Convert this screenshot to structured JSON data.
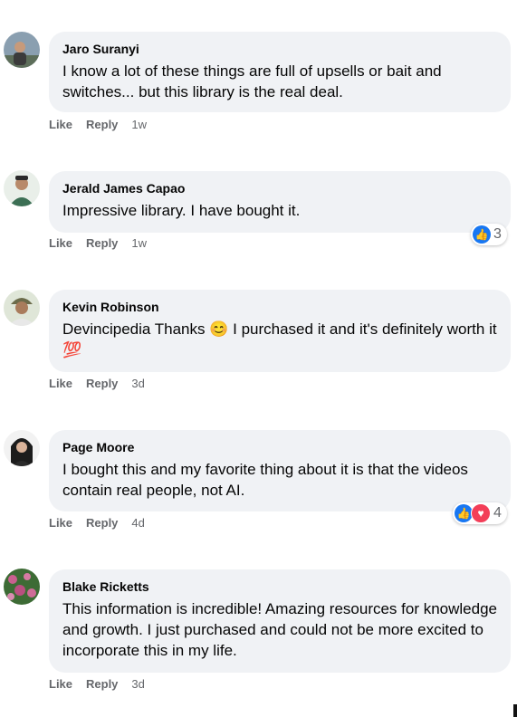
{
  "comments": [
    {
      "author": "Jaro Suranyi",
      "text": "I know a lot of these things are full of upsells or bait and switches... but this library is the real deal.",
      "like": "Like",
      "reply": "Reply",
      "time": "1w",
      "reaction_count": ""
    },
    {
      "author": "Jerald James Capao",
      "text": "Impressive library. I have bought it.",
      "like": "Like",
      "reply": "Reply",
      "time": "1w",
      "reaction_count": "3"
    },
    {
      "author": "Kevin Robinson",
      "text_before": "Devincipedia Thanks ",
      "emoji1": "😊",
      "text_mid": " I purchased it and it's definitely worth it ",
      "emoji2": "💯",
      "like": "Like",
      "reply": "Reply",
      "time": "3d"
    },
    {
      "author": "Page Moore",
      "text": "I bought this and my favorite thing about it is that the videos contain real people, not AI.",
      "like": "Like",
      "reply": "Reply",
      "time": "4d",
      "reaction_count": "4"
    },
    {
      "author": "Blake Ricketts",
      "text": "This information is incredible! Amazing resources for knowledge and growth. I just purchased and could not be more excited to incorporate this in my life.",
      "like": "Like",
      "reply": "Reply",
      "time": "3d"
    }
  ],
  "colors": {
    "bubble": "#f0f2f5",
    "meta": "#65676b",
    "like_blue": "#1877f2",
    "love_red": "#f33e58"
  },
  "icons": {
    "like": "thumbs-up-icon",
    "love": "heart-icon"
  }
}
